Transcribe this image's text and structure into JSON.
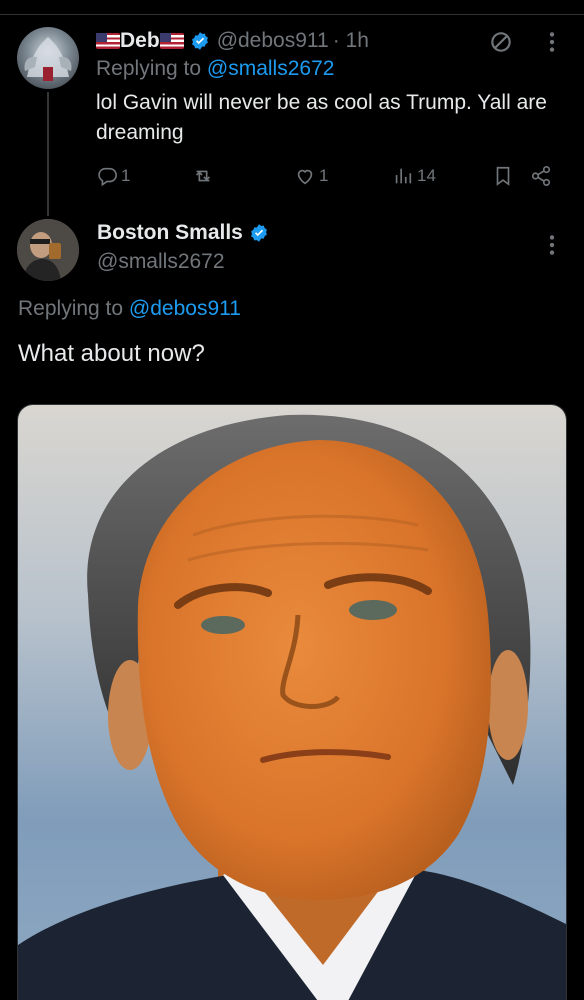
{
  "reply_tweet": {
    "display_name": "Deb",
    "handle": "@debos911",
    "time": "· 1h",
    "replying_prefix": "Replying to",
    "replying_to": "@smalls2672",
    "text": "lol Gavin will never be as cool as Trump. Yall are dreaming",
    "actions": {
      "replies": "1",
      "retweets": "",
      "likes": "1",
      "views": "14"
    }
  },
  "main_tweet": {
    "display_name": "Boston Smalls",
    "handle": "@smalls2672",
    "replying_prefix": "Replying to",
    "replying_to": "@debos911",
    "text": "What about now?"
  },
  "colors": {
    "background": "#000000",
    "text": "#e7e9ea",
    "muted": "#71767b",
    "link": "#1d9bf0",
    "verified": "#1d9bf0"
  },
  "icons": [
    "verified-badge-icon",
    "no-entry-icon",
    "more-options-icon",
    "reply-icon",
    "retweet-icon",
    "like-icon",
    "views-icon",
    "bookmark-icon",
    "share-icon",
    "us-flag-icon"
  ]
}
